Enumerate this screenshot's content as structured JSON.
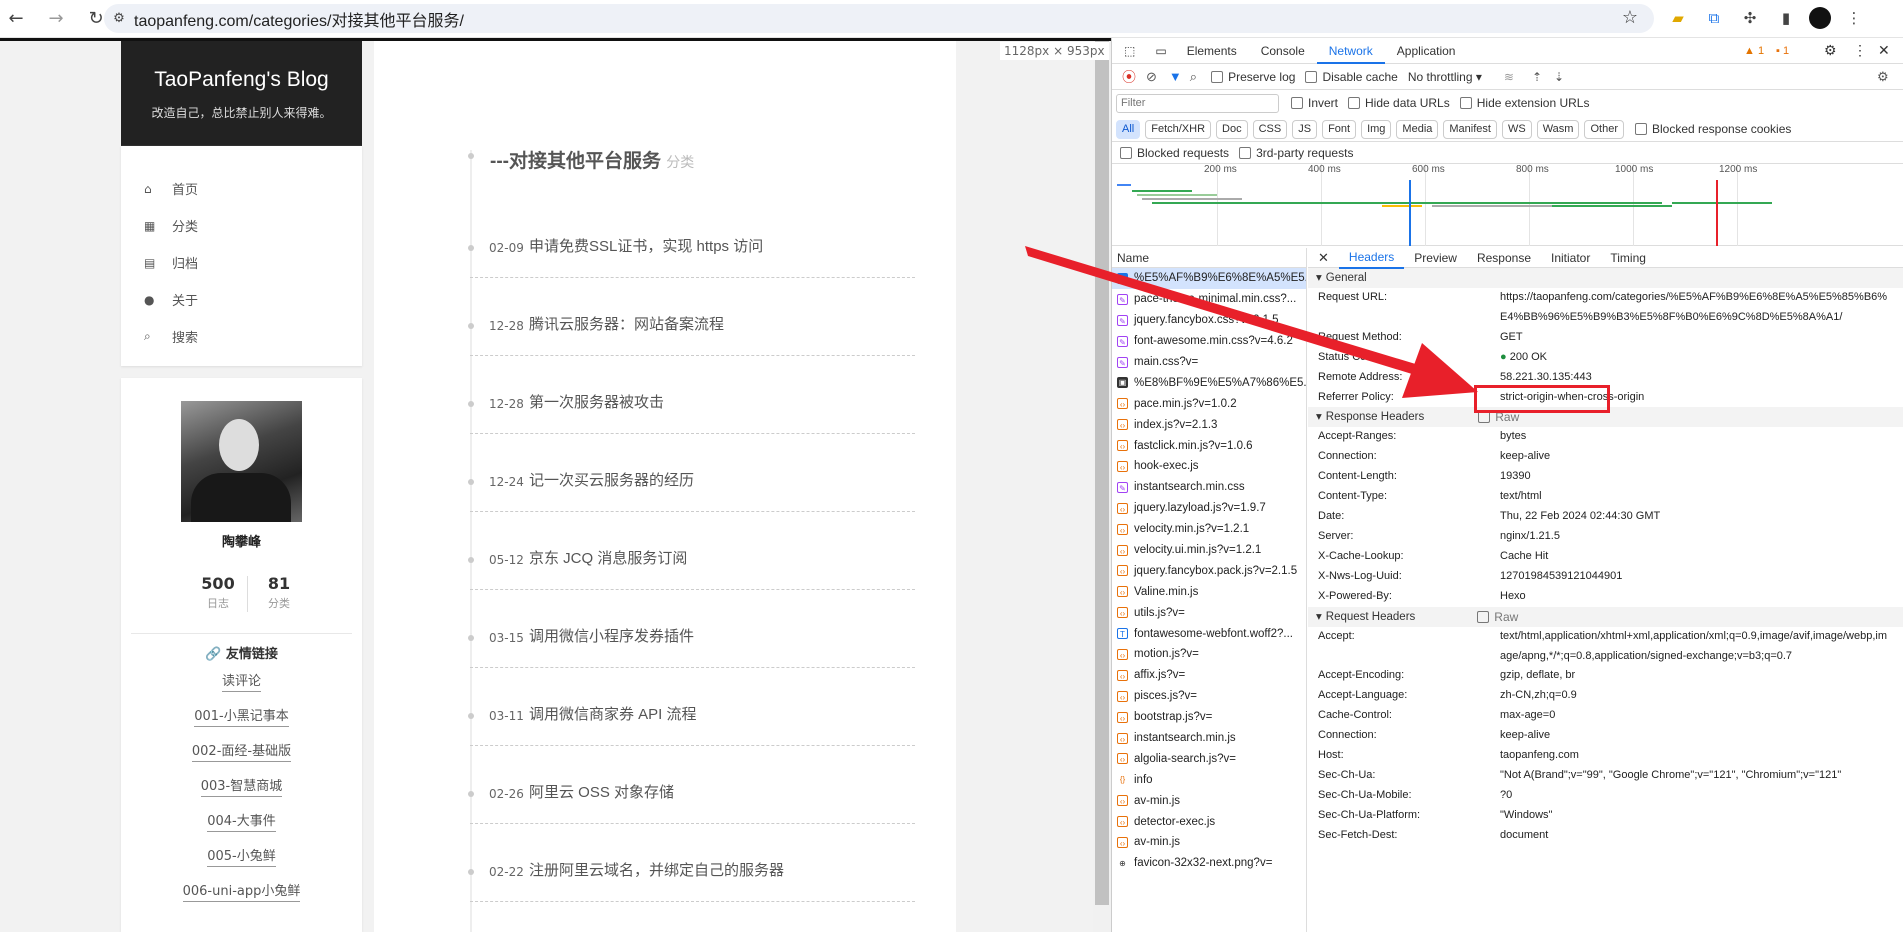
{
  "browser": {
    "url": "taopanfeng.com/categories/对接其他平台服务/",
    "back_icon": "←",
    "forward_icon": "→",
    "reload_icon": "↻"
  },
  "blog": {
    "brand_title": "TaoPanfeng's Blog",
    "brand_subtitle": "改造自己，总比禁止别人来得难。",
    "menu": [
      {
        "icon": "home-icon",
        "label": "首页"
      },
      {
        "icon": "grid-icon",
        "label": "分类"
      },
      {
        "icon": "archive-icon",
        "label": "归档"
      },
      {
        "icon": "user-icon",
        "label": "关于"
      },
      {
        "icon": "search-icon",
        "label": "搜索"
      }
    ],
    "author": "陶攀峰",
    "stats": [
      {
        "value": "500",
        "label": "日志"
      },
      {
        "value": "81",
        "label": "分类"
      }
    ],
    "links_title": "友情链接",
    "links": [
      "读评论",
      "001-小黑记事本",
      "002-面经-基础版",
      "003-智慧商城",
      "004-大事件",
      "005-小兔鲜",
      "006-uni-app小兔鲜"
    ],
    "category_title": "---对接其他平台服务",
    "category_suffix": "分类",
    "posts": [
      {
        "date": "02-09",
        "title": "申请免费SSL证书，实现 https 访问"
      },
      {
        "date": "12-28",
        "title": "腾讯云服务器：网站备案流程"
      },
      {
        "date": "12-28",
        "title": "第一次服务器被攻击"
      },
      {
        "date": "12-24",
        "title": "记一次买云服务器的经历"
      },
      {
        "date": "05-12",
        "title": "京东 JCQ 消息服务订阅"
      },
      {
        "date": "03-15",
        "title": "调用微信小程序发券插件"
      },
      {
        "date": "03-11",
        "title": "调用微信商家券 API 流程"
      },
      {
        "date": "02-26",
        "title": "阿里云 OSS 对象存储"
      },
      {
        "date": "02-22",
        "title": "注册阿里云域名，并绑定自己的服务器"
      }
    ]
  },
  "viewport_label": "1128px × 953px",
  "devtools": {
    "tabs": [
      "Elements",
      "Console",
      "Network",
      "Application"
    ],
    "active_tab": "Network",
    "warn_count": "1",
    "issue_count": "1",
    "toolbar": {
      "preserve_log": "Preserve log",
      "disable_cache": "Disable cache",
      "throttling": "No throttling"
    },
    "filter_placeholder": "Filter",
    "filter_opts": [
      "Invert",
      "Hide data URLs",
      "Hide extension URLs"
    ],
    "type_chips": [
      "All",
      "Fetch/XHR",
      "Doc",
      "CSS",
      "JS",
      "Font",
      "Img",
      "Media",
      "Manifest",
      "WS",
      "Wasm",
      "Other"
    ],
    "blocked_cookies": "Blocked response cookies",
    "blocked_requests": "Blocked requests",
    "third_party": "3rd-party requests",
    "timeline_ticks": [
      "200 ms",
      "400 ms",
      "600 ms",
      "800 ms",
      "1000 ms",
      "1200 ms"
    ],
    "name_header": "Name",
    "requests": [
      {
        "name": "%E5%AF%B9%E6%8E%A5%E5...",
        "type": "doc"
      },
      {
        "name": "pace-theme-minimal.min.css?...",
        "type": "css"
      },
      {
        "name": "jquery.fancybox.css?v=2.1.5",
        "type": "css"
      },
      {
        "name": "font-awesome.min.css?v=4.6.2",
        "type": "css"
      },
      {
        "name": "main.css?v=",
        "type": "css"
      },
      {
        "name": "%E8%BF%9E%E5%A7%86%E5...",
        "type": "img"
      },
      {
        "name": "pace.min.js?v=1.0.2",
        "type": "js"
      },
      {
        "name": "index.js?v=2.1.3",
        "type": "js"
      },
      {
        "name": "fastclick.min.js?v=1.0.6",
        "type": "js"
      },
      {
        "name": "hook-exec.js",
        "type": "js"
      },
      {
        "name": "instantsearch.min.css",
        "type": "css"
      },
      {
        "name": "jquery.lazyload.js?v=1.9.7",
        "type": "js"
      },
      {
        "name": "velocity.min.js?v=1.2.1",
        "type": "js"
      },
      {
        "name": "velocity.ui.min.js?v=1.2.1",
        "type": "js"
      },
      {
        "name": "jquery.fancybox.pack.js?v=2.1.5",
        "type": "js"
      },
      {
        "name": "Valine.min.js",
        "type": "js"
      },
      {
        "name": "utils.js?v=",
        "type": "js"
      },
      {
        "name": "fontawesome-webfont.woff2?...",
        "type": "font"
      },
      {
        "name": "motion.js?v=",
        "type": "js"
      },
      {
        "name": "affix.js?v=",
        "type": "js"
      },
      {
        "name": "pisces.js?v=",
        "type": "js"
      },
      {
        "name": "bootstrap.js?v=",
        "type": "js"
      },
      {
        "name": "instantsearch.min.js",
        "type": "js"
      },
      {
        "name": "algolia-search.js?v=",
        "type": "js"
      },
      {
        "name": "info",
        "type": "xhr"
      },
      {
        "name": "av-min.js",
        "type": "js"
      },
      {
        "name": "detector-exec.js",
        "type": "js"
      },
      {
        "name": "av-min.js",
        "type": "js"
      },
      {
        "name": "favicon-32x32-next.png?v=",
        "type": "icon"
      }
    ],
    "detail_tabs": [
      "Headers",
      "Preview",
      "Response",
      "Initiator",
      "Timing"
    ],
    "general_title": "General",
    "general": [
      {
        "k": "Request URL:",
        "v": "https://taopanfeng.com/categories/%E5%AF%B9%E6%8E%A5%E5%85%B6%E4%BB%96%E5%B9%B3%E5%8F%B0%E6%9C%8D%E5%8A%A1/"
      },
      {
        "k": "Request Method:",
        "v": "GET"
      },
      {
        "k": "Status Code:",
        "v": "200 OK"
      },
      {
        "k": "Remote Address:",
        "v": "58.221.30.135:443"
      },
      {
        "k": "Referrer Policy:",
        "v": "strict-origin-when-cross-origin"
      }
    ],
    "response_title": "Response Headers",
    "raw_label": "Raw",
    "response_headers": [
      {
        "k": "Accept-Ranges:",
        "v": "bytes"
      },
      {
        "k": "Connection:",
        "v": "keep-alive"
      },
      {
        "k": "Content-Length:",
        "v": "19390"
      },
      {
        "k": "Content-Type:",
        "v": "text/html"
      },
      {
        "k": "Date:",
        "v": "Thu, 22 Feb 2024 02:44:30 GMT"
      },
      {
        "k": "Server:",
        "v": "nginx/1.21.5"
      },
      {
        "k": "X-Cache-Lookup:",
        "v": "Cache Hit"
      },
      {
        "k": "X-Nws-Log-Uuid:",
        "v": "12701984539121044901"
      },
      {
        "k": "X-Powered-By:",
        "v": "Hexo"
      }
    ],
    "request_title": "Request Headers",
    "request_headers": [
      {
        "k": "Accept:",
        "v": "text/html,application/xhtml+xml,application/xml;q=0.9,image/avif,image/webp,image/apng,*/*;q=0.8,application/signed-exchange;v=b3;q=0.7"
      },
      {
        "k": "Accept-Encoding:",
        "v": "gzip, deflate, br"
      },
      {
        "k": "Accept-Language:",
        "v": "zh-CN,zh;q=0.9"
      },
      {
        "k": "Cache-Control:",
        "v": "max-age=0"
      },
      {
        "k": "Connection:",
        "v": "keep-alive"
      },
      {
        "k": "Host:",
        "v": "taopanfeng.com"
      },
      {
        "k": "Sec-Ch-Ua:",
        "v": "\"Not A(Brand\";v=\"99\", \"Google Chrome\";v=\"121\", \"Chromium\";v=\"121\""
      },
      {
        "k": "Sec-Ch-Ua-Mobile:",
        "v": "?0"
      },
      {
        "k": "Sec-Ch-Ua-Platform:",
        "v": "\"Windows\""
      },
      {
        "k": "Sec-Fetch-Dest:",
        "v": "document"
      }
    ]
  },
  "colors": {
    "accent": "#1a73e8",
    "annotation_red": "#e8202a",
    "status_green": "#1e8e3e"
  }
}
